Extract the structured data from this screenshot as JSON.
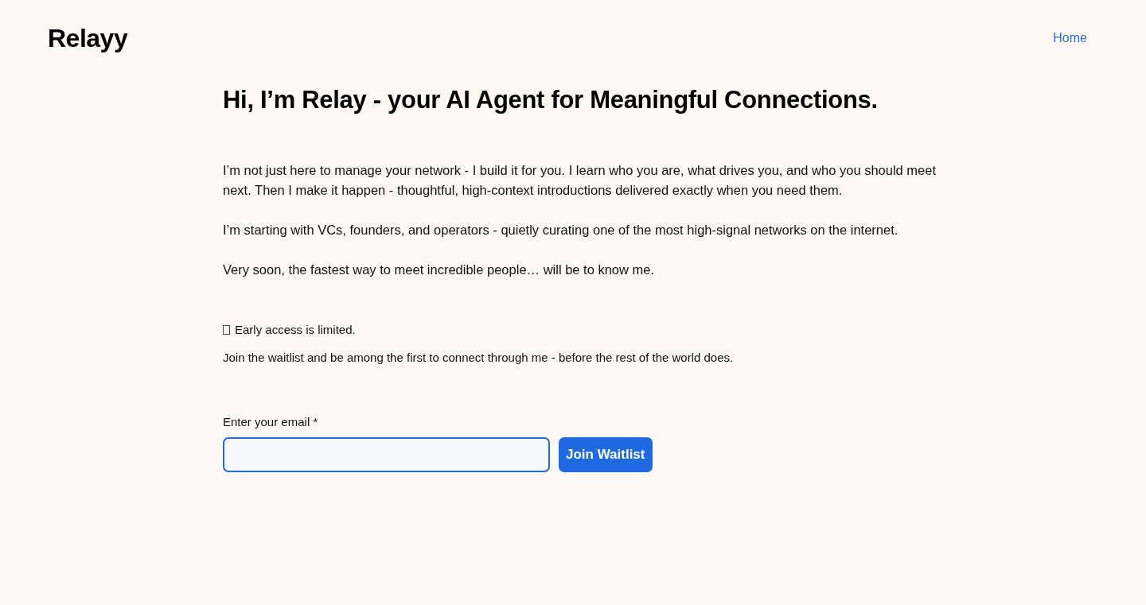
{
  "header": {
    "logo": "Relayy",
    "nav": [
      {
        "label": "Home"
      }
    ]
  },
  "heading": "Hi, I’m Relay - your AI Agent for Meaningful Connections.",
  "paragraphs": [
    "I’m not just here to manage your network - I build it for you. I learn who you are, what drives you, and who you should meet next. Then I make it happen - thoughtful, high-context introductions delivered exactly when you need them.",
    "I’m starting with VCs, founders, and operators - quietly curating one of the most high-signal networks on the internet.",
    "Very soon, the fastest way to meet incredible people… will be to know me."
  ],
  "notice": "Early access is limited.",
  "invite": "Join the waitlist and be among the first to connect through me - before the rest of the world does.",
  "form": {
    "label": "Enter your email *",
    "button": "Join Waitlist"
  }
}
